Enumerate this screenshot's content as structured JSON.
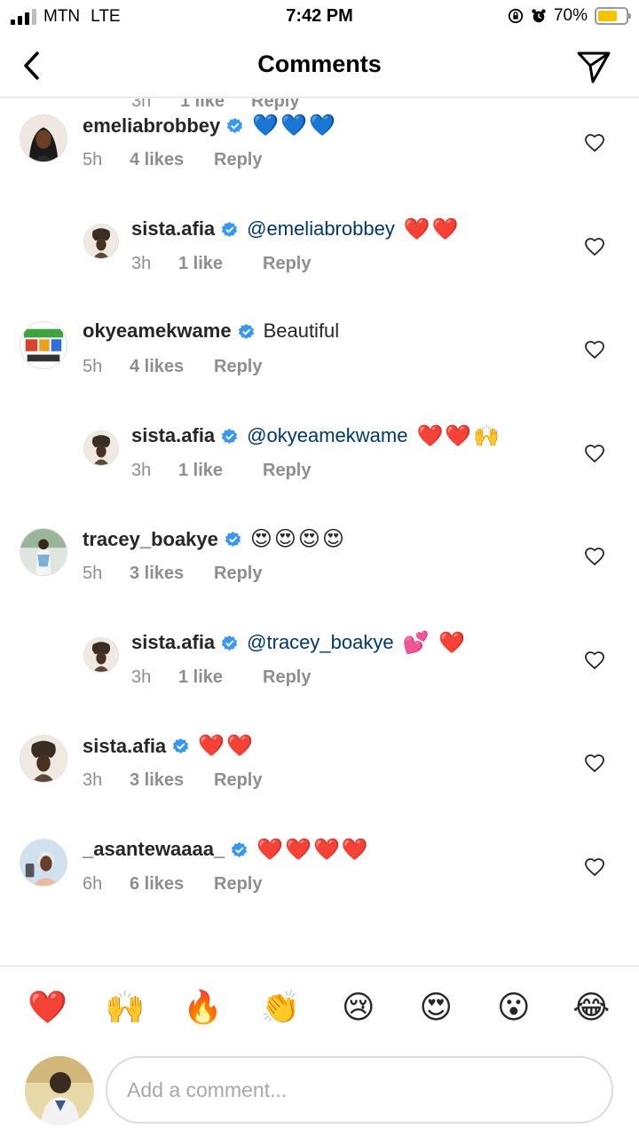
{
  "status_bar": {
    "carrier": "MTN",
    "network": "LTE",
    "time": "7:42 PM",
    "battery": "70%",
    "battery_level": 0.7,
    "battery_color": "#f5c400"
  },
  "header": {
    "title": "Comments",
    "back_icon": "chevron-left-icon",
    "action_icon": "send-icon"
  },
  "partial_comment": {
    "time": "3h",
    "likes": "1 like",
    "reply": "Reply"
  },
  "comments": [
    {
      "username": "emeliabrobbey",
      "verified": true,
      "mention": "",
      "text": "💙💙💙",
      "time": "5h",
      "likes": "4 likes",
      "reply": "Reply",
      "is_reply": false
    },
    {
      "username": "sista.afia",
      "verified": true,
      "mention": "@emeliabrobbey",
      "text": "❤️❤️",
      "time": "3h",
      "likes": "1 like",
      "reply": "Reply",
      "is_reply": true
    },
    {
      "username": "okyeamekwame",
      "verified": true,
      "mention": "",
      "text": "Beautiful",
      "time": "5h",
      "likes": "4 likes",
      "reply": "Reply",
      "is_reply": false
    },
    {
      "username": "sista.afia",
      "verified": true,
      "mention": "@okyeamekwame",
      "text": "❤️❤️🙌",
      "time": "3h",
      "likes": "1 like",
      "reply": "Reply",
      "is_reply": true
    },
    {
      "username": "tracey_boakye",
      "verified": true,
      "mention": "",
      "text": "😍😍😍😍",
      "time": "5h",
      "likes": "3 likes",
      "reply": "Reply",
      "is_reply": false
    },
    {
      "username": "sista.afia",
      "verified": true,
      "mention": "@tracey_boakye",
      "text": "💕 ❤️",
      "time": "3h",
      "likes": "1 like",
      "reply": "Reply",
      "is_reply": true
    },
    {
      "username": "sista.afia",
      "verified": true,
      "mention": "",
      "text": "❤️❤️",
      "time": "3h",
      "likes": "3 likes",
      "reply": "Reply",
      "is_reply": false
    },
    {
      "username": "_asantewaaaa_",
      "verified": true,
      "mention": "",
      "text": "❤️❤️❤️❤️",
      "time": "6h",
      "likes": "6 likes",
      "reply": "Reply",
      "is_reply": false
    }
  ],
  "reactions": [
    "❤️",
    "🙌",
    "🔥",
    "👏",
    "😢",
    "😍",
    "😮",
    "😂"
  ],
  "composer": {
    "placeholder": "Add a comment..."
  },
  "colors": {
    "mention": "#00376b",
    "meta": "#8e8e8e",
    "verified": "#3897f0",
    "divider": "#dbdbdb"
  }
}
